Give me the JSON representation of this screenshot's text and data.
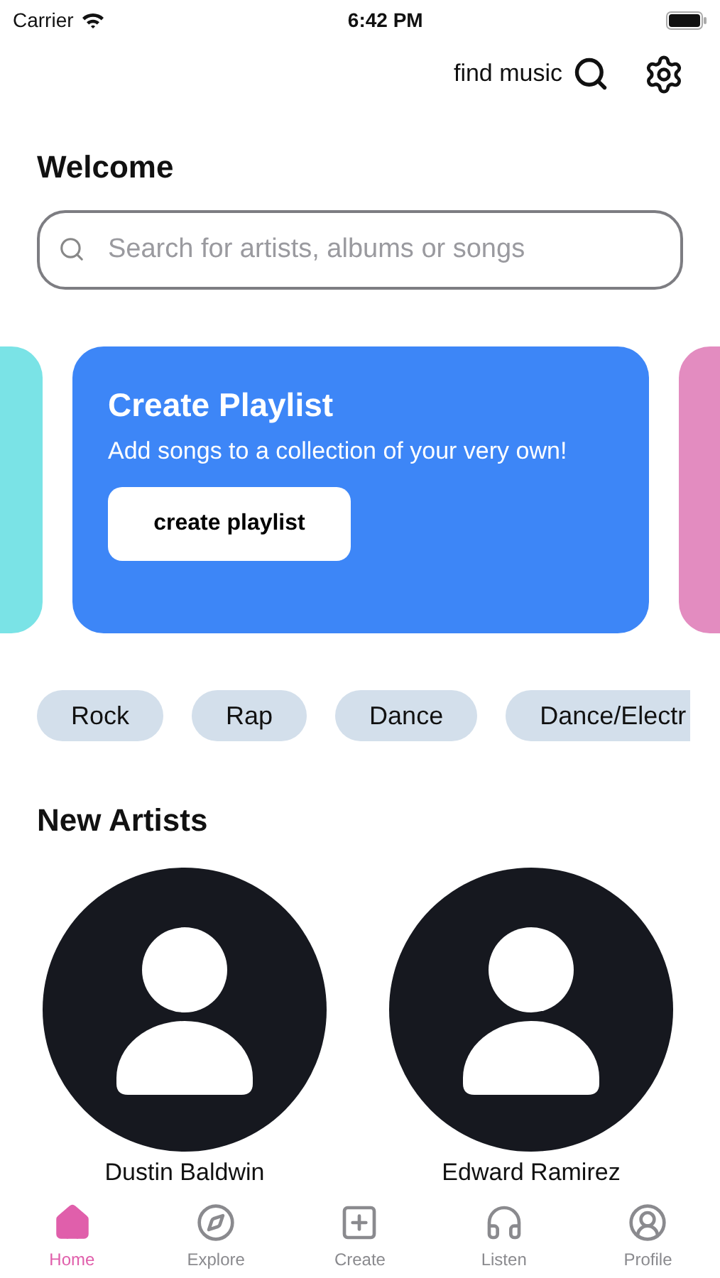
{
  "status_bar": {
    "carrier": "Carrier",
    "time": "6:42 PM"
  },
  "header": {
    "find_label": "find music"
  },
  "title": "Welcome",
  "search": {
    "placeholder": "Search for artists, albums or songs"
  },
  "cards": [
    {
      "color": "#7ae3e6"
    },
    {
      "color": "#3d86f7",
      "title": "Create Playlist",
      "description": "Add songs to a collection of your very own!",
      "button": "create playlist"
    },
    {
      "color": "#e38cc0"
    }
  ],
  "genres": [
    "Rock",
    "Rap",
    "Dance",
    "Dance/Electr"
  ],
  "new_artists": {
    "title": "New Artists",
    "artists": [
      {
        "name": "Dustin Baldwin"
      },
      {
        "name": "Edward Ramirez"
      }
    ]
  },
  "tabs": [
    {
      "kind": "home",
      "label": "Home",
      "selected": true
    },
    {
      "kind": "explore",
      "label": "Explore",
      "selected": false
    },
    {
      "kind": "create",
      "label": "Create",
      "selected": false
    },
    {
      "kind": "listen",
      "label": "Listen",
      "selected": false
    },
    {
      "kind": "profile",
      "label": "Profile",
      "selected": false
    }
  ]
}
